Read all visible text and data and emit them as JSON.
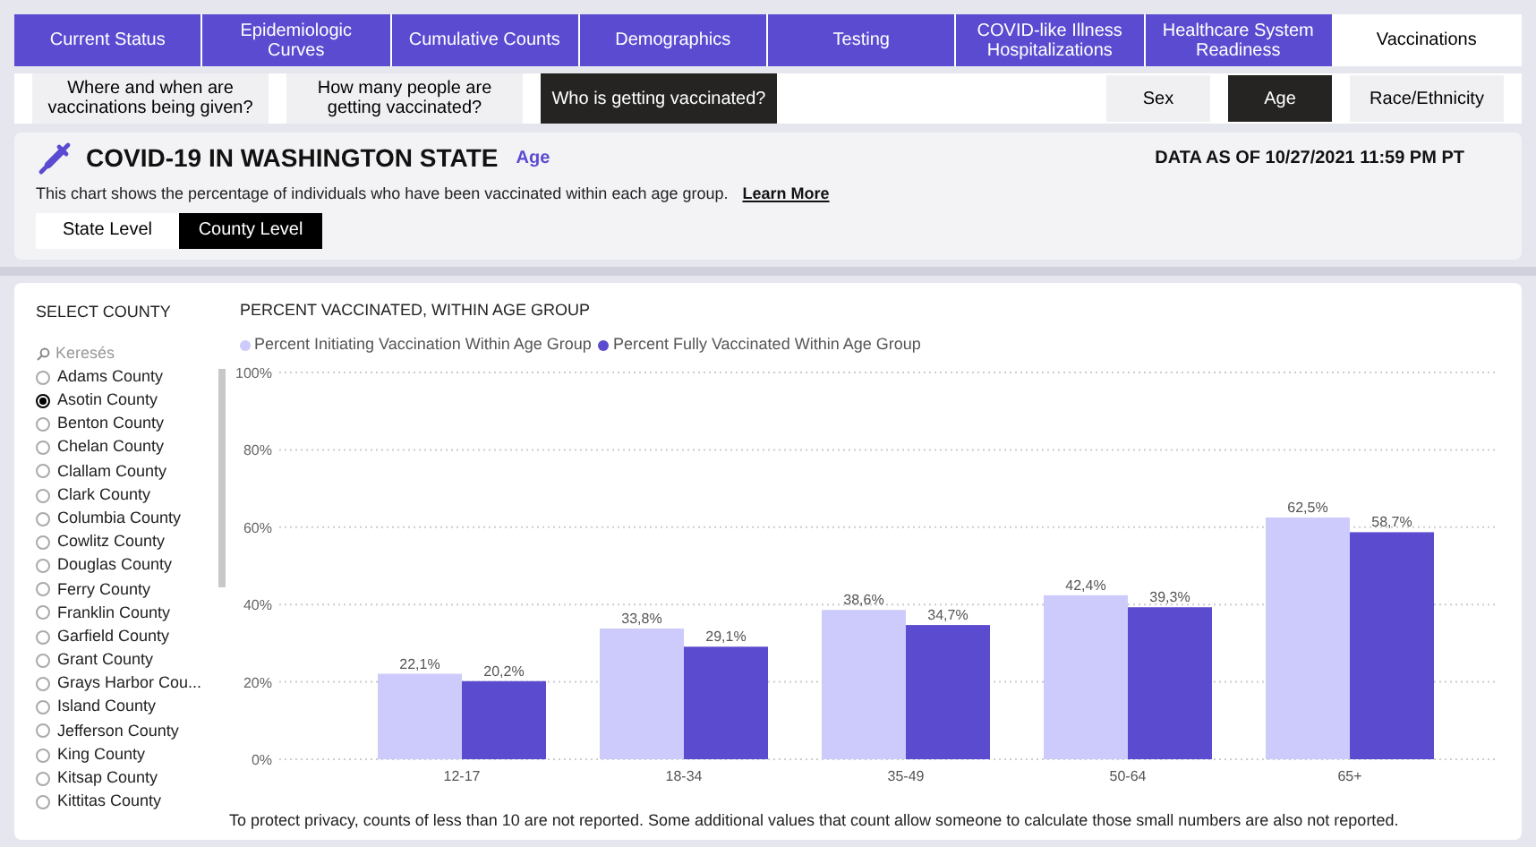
{
  "tabs": [
    {
      "label": "Current Status",
      "selected": false
    },
    {
      "label": "Epidemiologic Curves",
      "selected": false
    },
    {
      "label": "Cumulative Counts",
      "selected": false
    },
    {
      "label": "Demographics",
      "selected": false
    },
    {
      "label": "Testing",
      "selected": false
    },
    {
      "label": "COVID-like Illness Hospitalizations",
      "selected": false
    },
    {
      "label": "Healthcare System Readiness",
      "selected": false
    },
    {
      "label": "Vaccinations",
      "selected": true
    }
  ],
  "questions": [
    {
      "label": "Where and when are vaccinations being given?",
      "selected": false
    },
    {
      "label": "How many people are getting vaccinated?",
      "selected": false
    },
    {
      "label": "Who is getting vaccinated?",
      "selected": true
    }
  ],
  "groupings": [
    {
      "label": "Sex",
      "selected": false
    },
    {
      "label": "Age",
      "selected": true
    },
    {
      "label": "Race/Ethnicity",
      "selected": false
    }
  ],
  "header": {
    "title": "COVID-19 IN WASHINGTON STATE",
    "subtitle": "Age",
    "data_as_of": "DATA AS OF 10/27/2021 11:59 PM PT",
    "description": "This chart shows the percentage of individuals who have been vaccinated within each age group.",
    "link": "Learn More"
  },
  "levels": [
    {
      "label": "State Level",
      "selected": false
    },
    {
      "label": "County Level",
      "selected": true
    }
  ],
  "county_filter": {
    "title": "SELECT COUNTY",
    "placeholder": "Keresés",
    "items": [
      {
        "label": "Adams County",
        "selected": false
      },
      {
        "label": "Asotin County",
        "selected": true
      },
      {
        "label": "Benton County",
        "selected": false
      },
      {
        "label": "Chelan County",
        "selected": false
      },
      {
        "label": "Clallam County",
        "selected": false
      },
      {
        "label": "Clark County",
        "selected": false
      },
      {
        "label": "Columbia County",
        "selected": false
      },
      {
        "label": "Cowlitz County",
        "selected": false
      },
      {
        "label": "Douglas County",
        "selected": false
      },
      {
        "label": "Ferry County",
        "selected": false
      },
      {
        "label": "Franklin County",
        "selected": false
      },
      {
        "label": "Garfield County",
        "selected": false
      },
      {
        "label": "Grant County",
        "selected": false
      },
      {
        "label": "Grays Harbor Cou...",
        "selected": false
      },
      {
        "label": "Island County",
        "selected": false
      },
      {
        "label": "Jefferson County",
        "selected": false
      },
      {
        "label": "King County",
        "selected": false
      },
      {
        "label": "Kitsap County",
        "selected": false
      },
      {
        "label": "Kittitas County",
        "selected": false
      }
    ]
  },
  "chart": {
    "chart_data": {
      "type": "bar",
      "title": "PERCENT VACCINATED, WITHIN AGE GROUP",
      "categories": [
        "12-17",
        "18-34",
        "35-49",
        "50-64",
        "65+"
      ],
      "series": [
        {
          "name": "Percent Initiating Vaccination Within Age Group",
          "color": "#cccbfb",
          "values": [
            22.1,
            33.8,
            38.6,
            42.4,
            62.5
          ],
          "value_labels": [
            "22,1%",
            "33,8%",
            "38,6%",
            "42,4%",
            "62,5%"
          ]
        },
        {
          "name": "Percent Fully Vaccinated Within Age Group",
          "color": "#5b4bcf",
          "values": [
            20.2,
            29.1,
            34.7,
            39.3,
            58.7
          ],
          "value_labels": [
            "20,2%",
            "29,1%",
            "34,7%",
            "39,3%",
            "58,7%"
          ]
        }
      ],
      "ylim": [
        0,
        100
      ],
      "yticks": [
        {
          "value": 0,
          "label": "0%"
        },
        {
          "value": 20,
          "label": "20%"
        },
        {
          "value": 40,
          "label": "40%"
        },
        {
          "value": 60,
          "label": "60%"
        },
        {
          "value": 80,
          "label": "80%"
        },
        {
          "value": 100,
          "label": "100%"
        }
      ],
      "data_labels": true,
      "grid": true
    },
    "footnote": "To protect privacy, counts of less than 10 are not reported. Some additional values that count allow someone to calculate those small numbers are also not reported."
  }
}
